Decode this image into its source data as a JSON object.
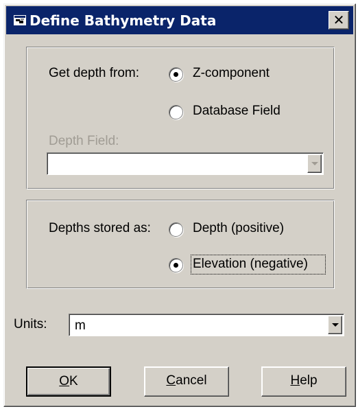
{
  "window": {
    "title": "Define Bathymetry Data",
    "close_label": "✕"
  },
  "depth_source": {
    "label": "Get depth from:",
    "options": [
      {
        "label": "Z-component",
        "selected": true
      },
      {
        "label": "Database Field",
        "selected": false
      }
    ]
  },
  "depth_field": {
    "label": "Depth Field:",
    "value": "",
    "enabled": false
  },
  "depth_storage": {
    "label": "Depths stored as:",
    "options": [
      {
        "label": "Depth (positive)",
        "selected": false
      },
      {
        "label": "Elevation (negative)",
        "selected": true
      }
    ]
  },
  "units": {
    "label": "Units:",
    "value": "m"
  },
  "buttons": {
    "ok": "OK",
    "cancel": "Cancel",
    "help": "Help"
  },
  "colors": {
    "titlebar": "#0a246a",
    "face": "#d4d0c8"
  }
}
